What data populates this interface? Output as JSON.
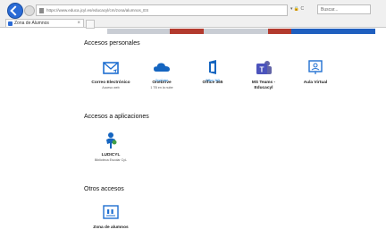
{
  "browser": {
    "url": "https://www.educa.jcyl.es/educacyl/cm/zona/alumnos_ES",
    "search_placeholder": "Buscar...",
    "tools": "▾ 🔒 C",
    "tab_title": "Zona de Alumnos"
  },
  "site": {
    "colors": {
      "accent": "#2a6bd6",
      "red": "#c0392b",
      "blue": "#1f5fbf"
    }
  },
  "sections": {
    "personal": {
      "title": "Accesos personales",
      "items": [
        {
          "label": "Correo Electrónico",
          "sub": "Acceso web"
        },
        {
          "label": "OneDrive",
          "sub": "1 TB en la nube",
          "brand": "OneDrive"
        },
        {
          "label": "Office 365",
          "sub": "",
          "brand": "Office 365"
        },
        {
          "label": "MS Teams -",
          "label2": "Educacyl",
          "sub": ""
        },
        {
          "label": "Aula Virtual",
          "sub": ""
        }
      ]
    },
    "apps": {
      "title": "Accesos a aplicaciones",
      "items": [
        {
          "label": "LUDICYL",
          "sub": "Biblioteca Escolar CyL"
        }
      ]
    },
    "others": {
      "title": "Otros accesos",
      "items": [
        {
          "label": "Zona de alumnos",
          "sub": ""
        }
      ]
    }
  }
}
